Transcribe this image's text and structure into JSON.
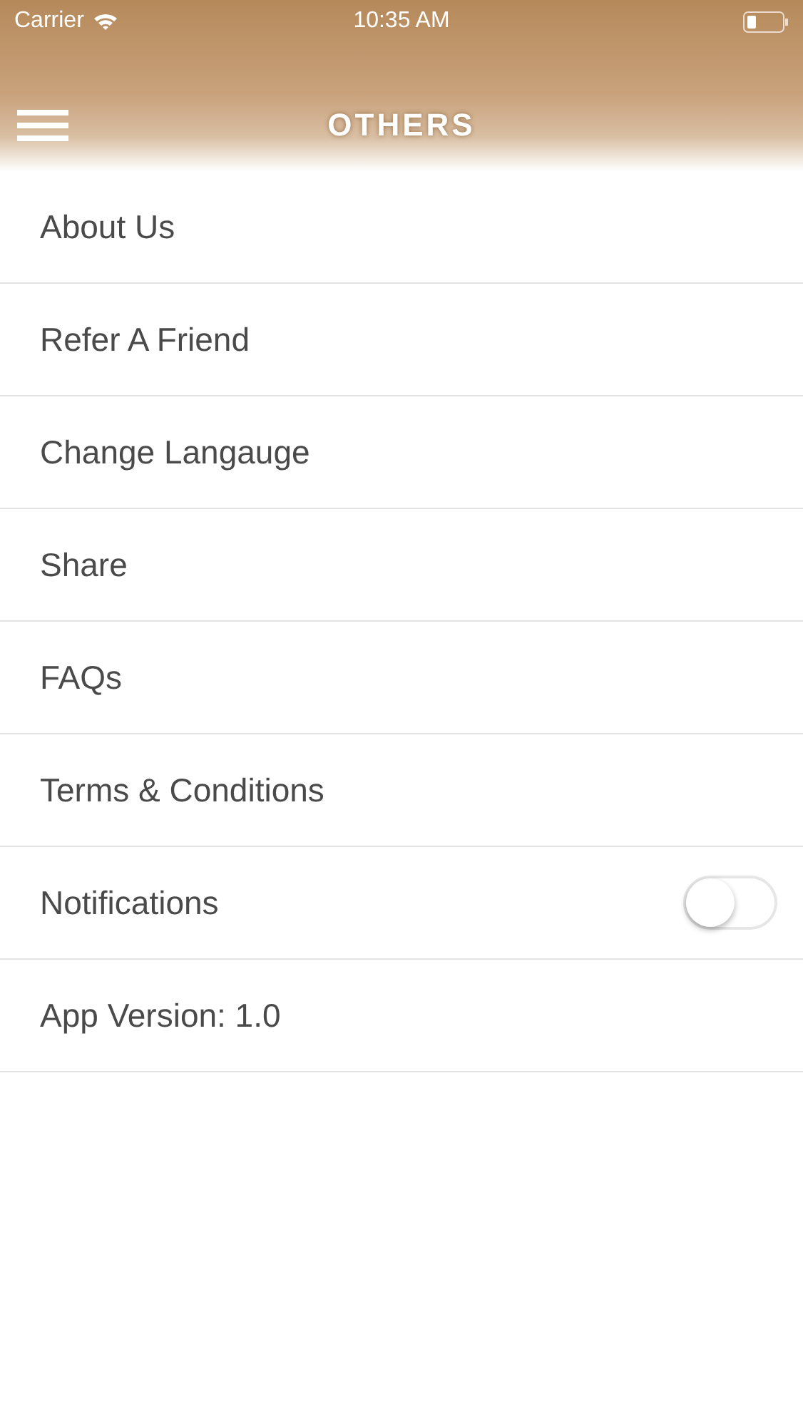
{
  "status_bar": {
    "carrier": "Carrier",
    "time": "10:35 AM"
  },
  "header": {
    "title": "OTHERS"
  },
  "menu": [
    {
      "kind": "link",
      "label": "About Us"
    },
    {
      "kind": "link",
      "label": "Refer A Friend"
    },
    {
      "kind": "link",
      "label": "Change Langauge"
    },
    {
      "kind": "link",
      "label": "Share"
    },
    {
      "kind": "link",
      "label": "FAQs"
    },
    {
      "kind": "link",
      "label": "Terms & Conditions"
    },
    {
      "kind": "toggle",
      "label": "Notifications",
      "on": false
    },
    {
      "kind": "info",
      "label": "App Version: 1.0"
    }
  ]
}
